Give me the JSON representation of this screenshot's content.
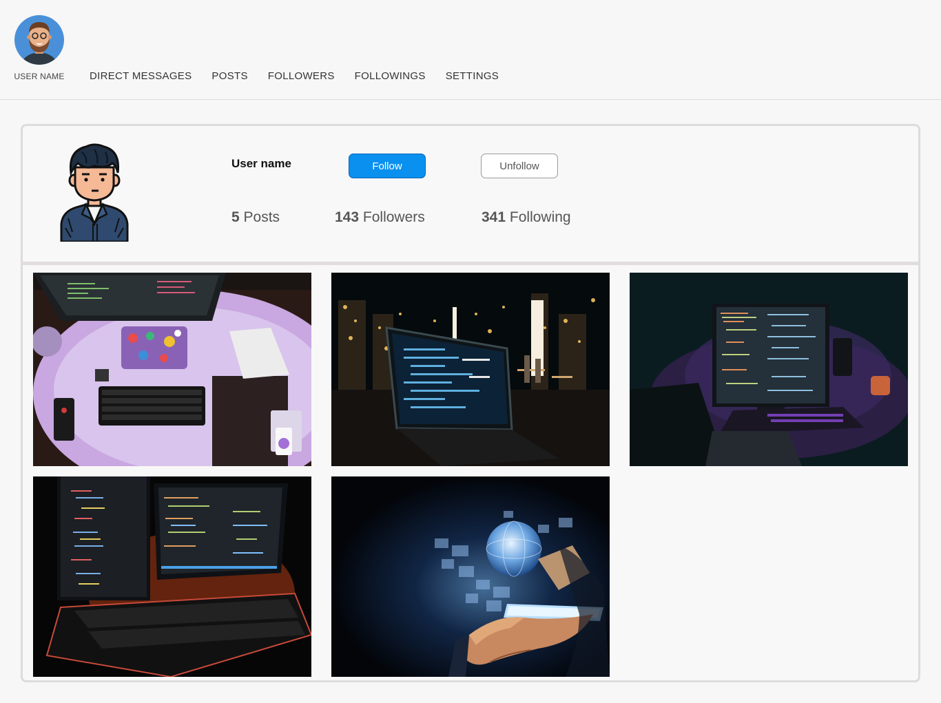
{
  "nav": {
    "username": "USER NAME",
    "links": [
      "DIRECT MESSAGES",
      "POSTS",
      "FOLLOWERS",
      "FOLLOWINGS",
      "SETTINGS"
    ],
    "avatar_icon": "bearded-man-avatar-icon"
  },
  "profile": {
    "name": "User name",
    "avatar_icon": "developer-avatar-icon",
    "follow_label": "Follow",
    "unfollow_label": "Unfollow",
    "stats": {
      "posts_count": "5",
      "posts_label": "Posts",
      "followers_count": "143",
      "followers_label": "Followers",
      "following_count": "341",
      "following_label": "Following"
    }
  },
  "posts": [
    {
      "subject": "desk with laptop, keyboard and notebook under purple light"
    },
    {
      "subject": "laptop with code at night in front of city skyline"
    },
    {
      "subject": "monitor with code in dark room with purple light"
    },
    {
      "subject": "monitors with code and backlit keyboard"
    },
    {
      "subject": "hand holding phone with holographic globe"
    }
  ],
  "colors": {
    "accent": "#0a90ef",
    "border": "#dcdcdc",
    "background": "#f7f7f7"
  }
}
